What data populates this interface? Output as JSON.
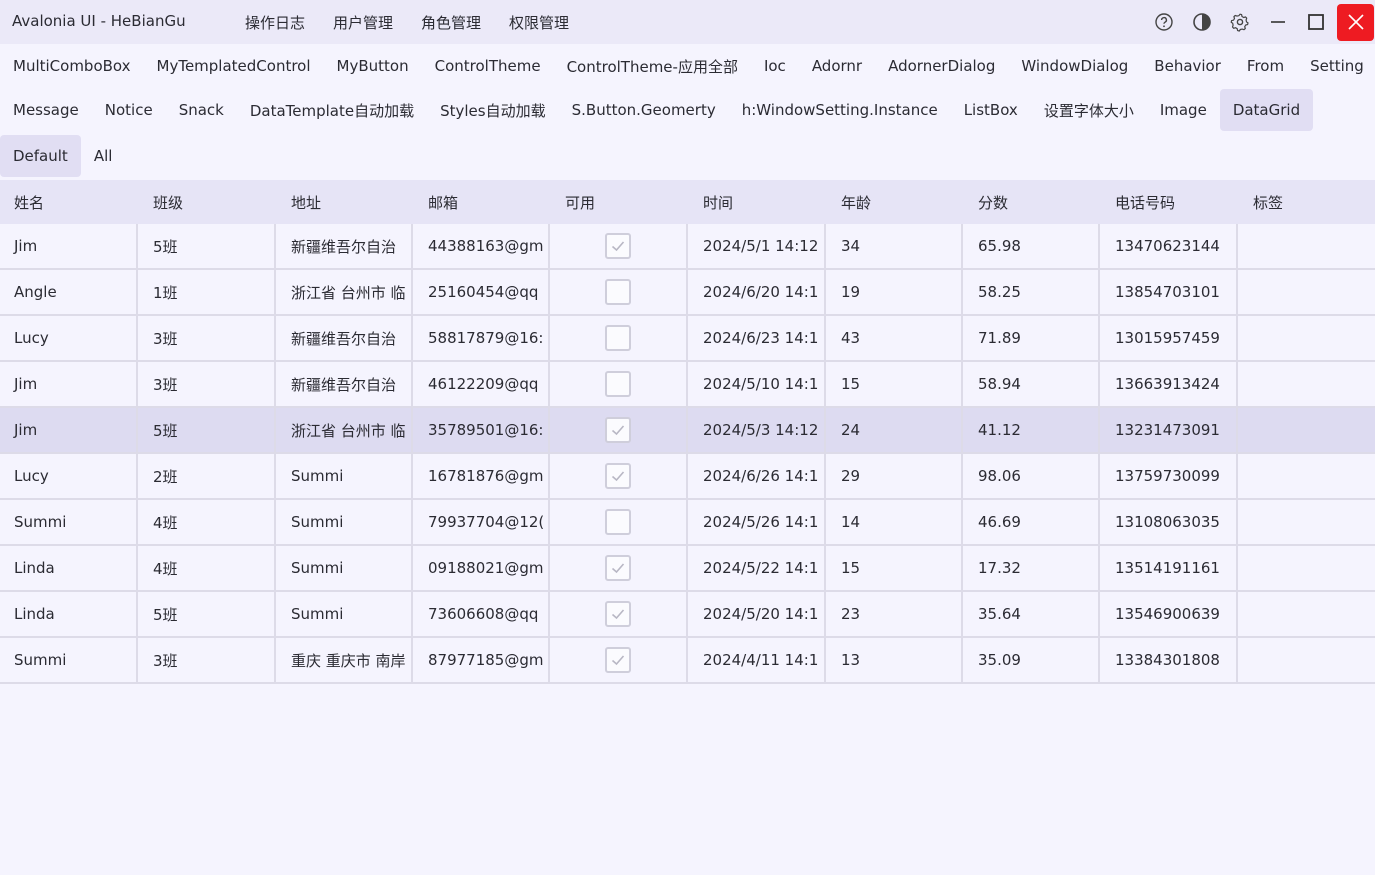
{
  "window": {
    "title": "Avalonia UI - HeBianGu",
    "menu": [
      "操作日志",
      "用户管理",
      "角色管理",
      "权限管理"
    ],
    "close_color": "#ee1b22"
  },
  "tabs_row1": [
    "MultiComboBox",
    "MyTemplatedControl",
    "MyButton",
    "ControlTheme",
    "ControlTheme-应用全部",
    "Ioc",
    "Adornr",
    "AdornerDialog",
    "WindowDialog",
    "Behavior",
    "From",
    "Setting"
  ],
  "tabs_row2": [
    "Message",
    "Notice",
    "Snack",
    "DataTemplate自动加载",
    "Styles自动加载",
    "S.Button.Geomerty",
    "h:WindowSetting.Instance",
    "ListBox",
    "设置字体大小",
    "Image",
    "DataGrid"
  ],
  "tabs_row2_selected": "DataGrid",
  "subtabs": [
    "Default",
    "All"
  ],
  "subtabs_selected": "Default",
  "grid": {
    "columns": [
      "姓名",
      "班级",
      "地址",
      "邮箱",
      "可用",
      "时间",
      "年龄",
      "分数",
      "电话号码",
      "标签"
    ],
    "selected_row": 4,
    "rows": [
      {
        "name": "Jim",
        "class": "5班",
        "address": "新疆维吾尔自治",
        "email": "44388163@gm",
        "enabled": true,
        "time": "2024/5/1 14:12",
        "age": "34",
        "score": "65.98",
        "phone": "13470623144",
        "tag": ""
      },
      {
        "name": "Angle",
        "class": "1班",
        "address": "浙江省 台州市 临",
        "email": "25160454@qq",
        "enabled": false,
        "time": "2024/6/20 14:1",
        "age": "19",
        "score": "58.25",
        "phone": "13854703101",
        "tag": ""
      },
      {
        "name": "Lucy",
        "class": "3班",
        "address": "新疆维吾尔自治",
        "email": "58817879@16:",
        "enabled": false,
        "time": "2024/6/23 14:1",
        "age": "43",
        "score": "71.89",
        "phone": "13015957459",
        "tag": ""
      },
      {
        "name": "Jim",
        "class": "3班",
        "address": "新疆维吾尔自治",
        "email": "46122209@qq",
        "enabled": false,
        "time": "2024/5/10 14:1",
        "age": "15",
        "score": "58.94",
        "phone": "13663913424",
        "tag": ""
      },
      {
        "name": "Jim",
        "class": "5班",
        "address": "浙江省 台州市 临",
        "email": "35789501@16:",
        "enabled": true,
        "time": "2024/5/3 14:12",
        "age": "24",
        "score": "41.12",
        "phone": "13231473091",
        "tag": ""
      },
      {
        "name": "Lucy",
        "class": "2班",
        "address": "Summi",
        "email": "16781876@gm",
        "enabled": true,
        "time": "2024/6/26 14:1",
        "age": "29",
        "score": "98.06",
        "phone": "13759730099",
        "tag": ""
      },
      {
        "name": "Summi",
        "class": "4班",
        "address": "Summi",
        "email": "79937704@12(",
        "enabled": false,
        "time": "2024/5/26 14:1",
        "age": "14",
        "score": "46.69",
        "phone": "13108063035",
        "tag": ""
      },
      {
        "name": "Linda",
        "class": "4班",
        "address": "Summi",
        "email": "09188021@gm",
        "enabled": true,
        "time": "2024/5/22 14:1",
        "age": "15",
        "score": "17.32",
        "phone": "13514191161",
        "tag": ""
      },
      {
        "name": "Linda",
        "class": "5班",
        "address": "Summi",
        "email": "73606608@qq",
        "enabled": true,
        "time": "2024/5/20 14:1",
        "age": "23",
        "score": "35.64",
        "phone": "13546900639",
        "tag": ""
      },
      {
        "name": "Summi",
        "class": "3班",
        "address": "重庆 重庆市 南岸",
        "email": "87977185@gm",
        "enabled": true,
        "time": "2024/4/11 14:1",
        "age": "13",
        "score": "35.09",
        "phone": "13384301808",
        "tag": ""
      }
    ]
  }
}
